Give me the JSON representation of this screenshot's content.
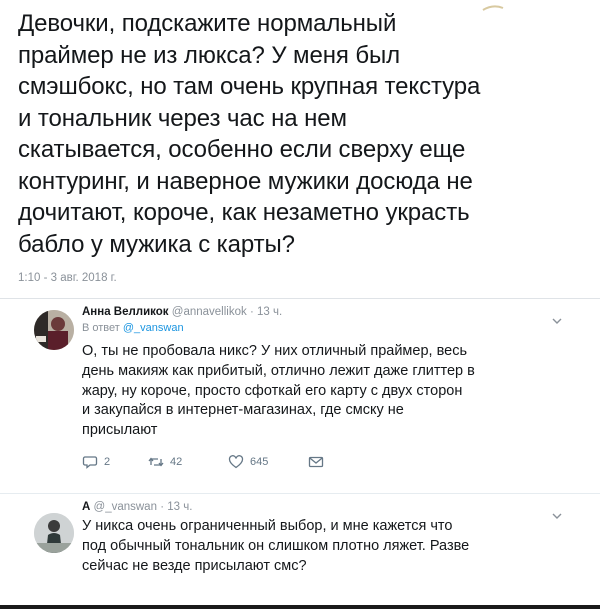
{
  "main_tweet": {
    "text": "Девочки, подскажите нормальный\nпраймер не из люкса? У меня был\nсмэшбокс,  но там очень крупная текстура\nи тональник через час на нем\nскатывается,  особенно если сверху еще\nконтуринг, и наверное мужики досюда не\nдочитают, короче, как незаметно украсть\nбабло у мужика с карты?",
    "meta": "1:10 - 3 авг. 2018 г."
  },
  "reply1": {
    "name": "Анна Велликок",
    "handle": "@annavellikok",
    "time": "· 13 ч.",
    "reply_to_prefix": "В ответ",
    "reply_to_handle": "@_vanswan",
    "text": "О, ты не пробовала никс? У них отличный праймер, весь\nдень макияж как прибитый, отлично лежит даже глиттер в\nжару, ну короче, просто сфоткай его карту с двух сторон\nи закупайся в интернет-магазинах, где смску не\nприсылают",
    "replies": "2",
    "retweets": "42",
    "likes": "645"
  },
  "reply2": {
    "name": "A",
    "handle": "@_vanswan",
    "time": "· 13 ч.",
    "text": "У никса очень ограниченный выбор, и мне кажется что\nпод обычный тональник он слишком плотно ляжет. Разве\nсейчас не везде присылают смс?"
  },
  "icons": {
    "reply": "speech-bubble-icon",
    "retweet": "retweet-icon",
    "like": "heart-icon",
    "dm": "envelope-icon",
    "more": "chevron-down-icon"
  },
  "colors": {
    "text": "#14171a",
    "muted": "#8a9199",
    "link": "#1b95e0"
  }
}
